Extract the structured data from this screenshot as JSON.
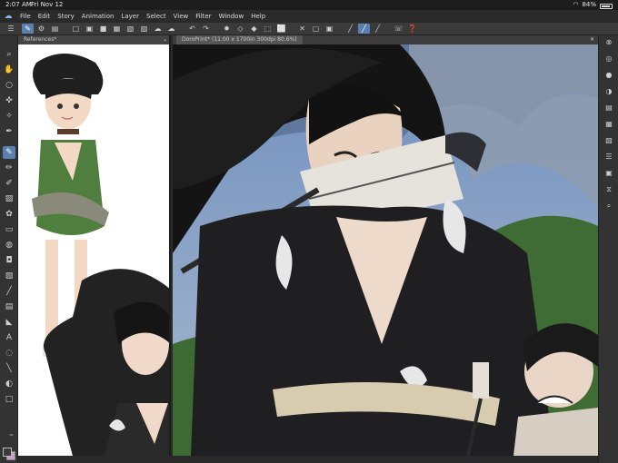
{
  "status_bar": {
    "time": "2:07 AM",
    "date": "Fri Nov 12",
    "battery": "84%"
  },
  "menu": {
    "items": [
      "File",
      "Edit",
      "Story",
      "Animation",
      "Layer",
      "Select",
      "View",
      "Filter",
      "Window",
      "Help"
    ]
  },
  "reference_panel": {
    "tab_label": "References*"
  },
  "canvas": {
    "tab_label": "DoroPrint* (11.00 x 1700in 300dpi 80.6%)"
  },
  "colors": {
    "accent": "#5a7fb0",
    "toolbar_bg": "#3a3a3a",
    "panel_bg": "#333333"
  }
}
